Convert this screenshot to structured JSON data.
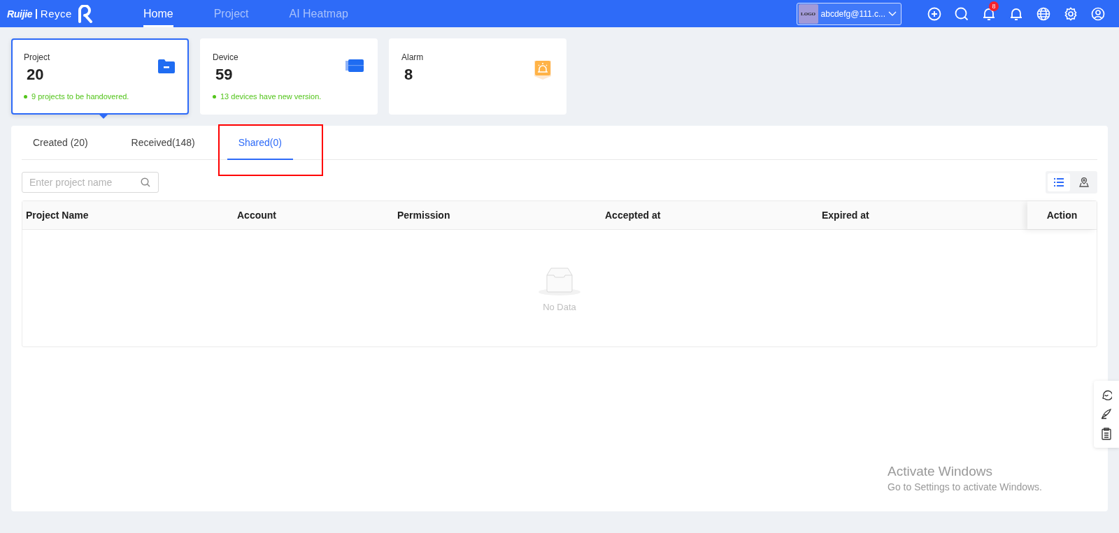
{
  "header": {
    "brand": "Ruijie",
    "product": "Reyce",
    "nav": [
      {
        "label": "Home",
        "selected": true
      },
      {
        "label": "Project",
        "selected": false
      },
      {
        "label": "AI Heatmap",
        "selected": false
      }
    ],
    "account": {
      "logo": "LOGO",
      "name": "abcdefg@111.c..."
    },
    "notification_count": "8"
  },
  "cards": [
    {
      "kind": "project",
      "label": "Project",
      "value": "20",
      "note": "9 projects to be handovered.",
      "selected": true
    },
    {
      "kind": "device",
      "label": "Device",
      "value": "59",
      "note": "13 devices have new version.",
      "selected": false
    },
    {
      "kind": "alarm",
      "label": "Alarm",
      "value": "8",
      "selected": false
    }
  ],
  "tabs": [
    {
      "label": "Created (20)",
      "selected": false
    },
    {
      "label": "Received(148)",
      "selected": false
    },
    {
      "label": "Shared(0)",
      "selected": true
    }
  ],
  "search": {
    "placeholder": "Enter project name"
  },
  "view_toggle": [
    {
      "kind": "list",
      "selected": true
    },
    {
      "kind": "map",
      "selected": false
    }
  ],
  "table": {
    "columns": [
      "Project Name",
      "Account",
      "Permission",
      "Accepted at",
      "Expired at",
      "Action"
    ],
    "empty_text": "No Data"
  },
  "os_notice": {
    "title": "Activate Windows",
    "text": "Go to Settings to activate Windows."
  }
}
